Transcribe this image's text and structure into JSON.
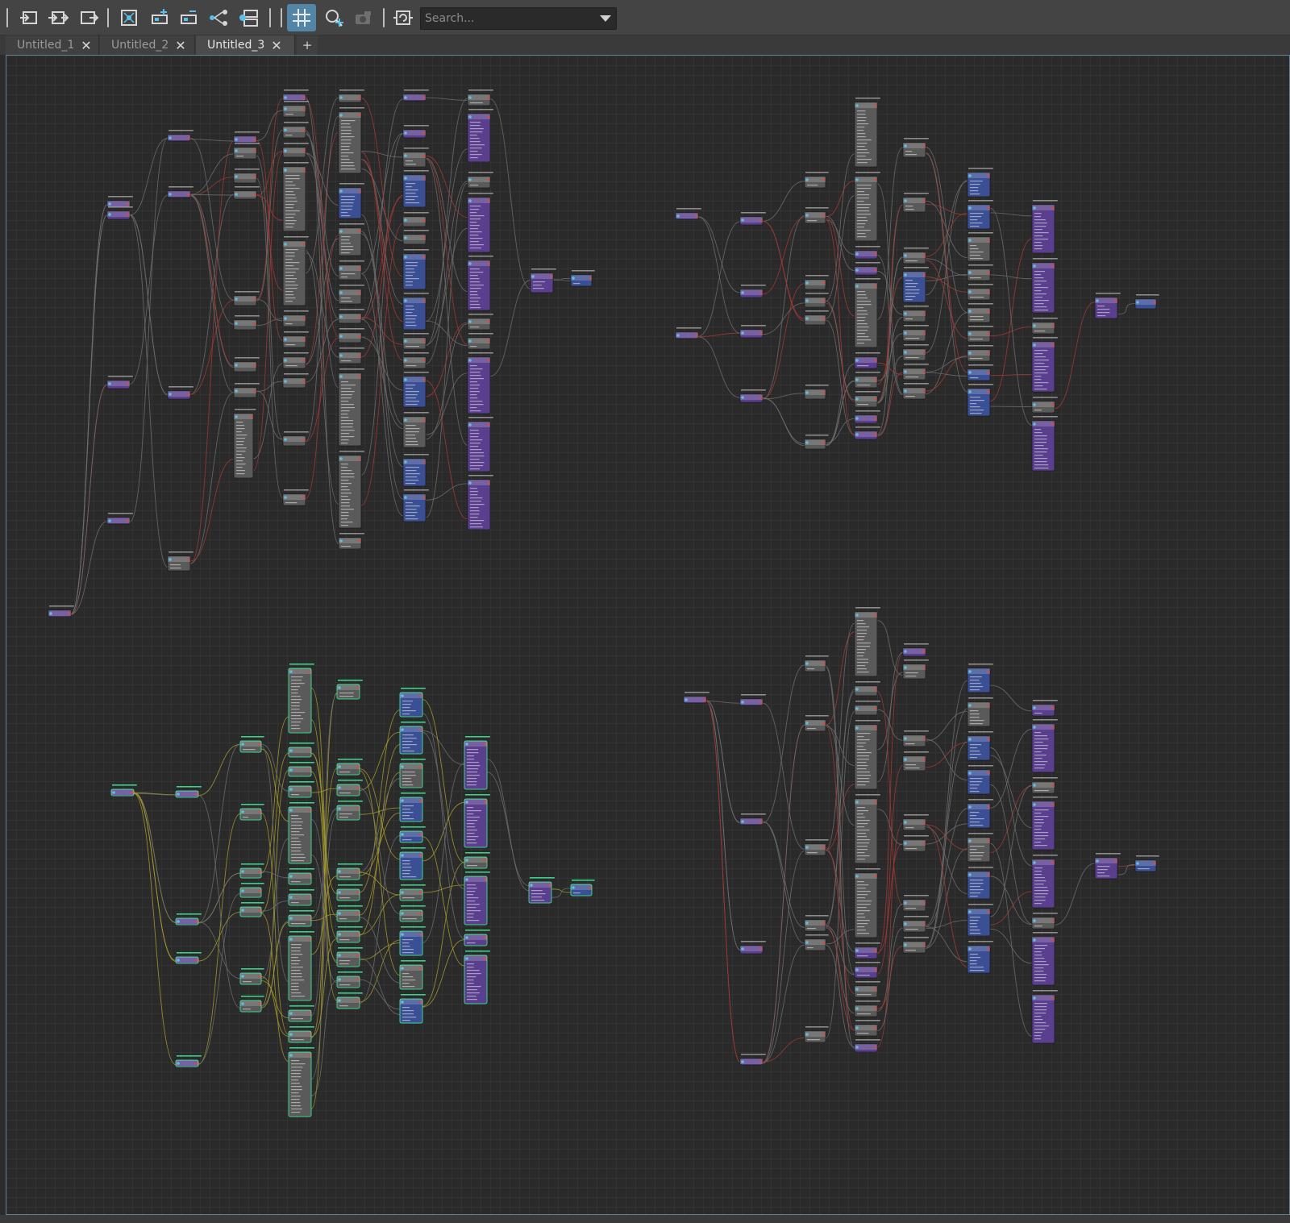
{
  "toolbar": {
    "buttons": [
      {
        "name": "input-connections-button",
        "icon": "input-connections-icon"
      },
      {
        "name": "input-output-connections-button",
        "icon": "input-output-connections-icon"
      },
      {
        "name": "output-connections-button",
        "icon": "output-connections-icon"
      },
      {
        "name": "frame-all-button",
        "icon": "frame-all-icon"
      },
      {
        "name": "add-selected-button",
        "icon": "add-selected-icon"
      },
      {
        "name": "remove-selected-button",
        "icon": "remove-selected-icon"
      },
      {
        "name": "graph-layout-button",
        "icon": "graph-layout-icon"
      },
      {
        "name": "toggle-attributes-button",
        "icon": "toggle-attributes-icon"
      },
      {
        "name": "grid-snap-button",
        "icon": "grid-icon",
        "active": true
      },
      {
        "name": "create-node-button",
        "icon": "create-node-icon"
      },
      {
        "name": "camera-button",
        "icon": "camera-icon"
      },
      {
        "name": "reload-button",
        "icon": "reload-icon"
      }
    ],
    "search_placeholder": "Search..."
  },
  "tabs": [
    {
      "label": "Untitled_1",
      "active": false
    },
    {
      "label": "Untitled_2",
      "active": false
    },
    {
      "label": "Untitled_3",
      "active": true
    }
  ],
  "add_tab_label": "+",
  "colors": {
    "toolbar_bg": "#444444",
    "canvas_bg": "#2a2a2a",
    "active_button": "#5285a6",
    "node_purple": "#5b3f8f",
    "node_blue": "#3b4f95",
    "node_gray": "#5a5a5a",
    "wire_gray": "#6d6d6d",
    "wire_red": "#a23a36",
    "wire_yellow": "#a59a2c",
    "highlight_green": "#3ad28a"
  }
}
